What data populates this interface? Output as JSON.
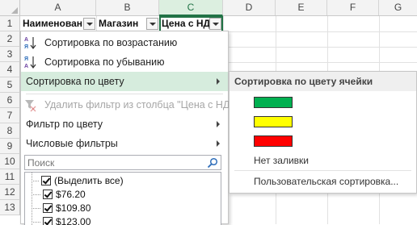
{
  "columns": [
    "A",
    "B",
    "C",
    "D",
    "E",
    "F",
    "G"
  ],
  "rows": [
    "1",
    "2",
    "3",
    "4",
    "5",
    "6",
    "7",
    "8",
    "9",
    "10",
    "11",
    "12",
    "13"
  ],
  "headers": {
    "a": "Наименован",
    "b": "Магазин",
    "c": "Цена с НДС"
  },
  "menu": {
    "sort_asc": "Сортировка по возрастанию",
    "sort_desc": "Сортировка по убыванию",
    "sort_by_color": "Сортировка по цвету",
    "clear_filter": "Удалить фильтр из столбца \"Цена с НДС\"",
    "filter_by_color": "Фильтр по цвету",
    "number_filters": "Числовые фильтры",
    "search_placeholder": "Поиск",
    "list_items": [
      "(Выделить все)",
      "$76.20",
      "$109.80",
      "$123.00"
    ]
  },
  "submenu": {
    "title": "Сортировка по цвету ячейки",
    "colors": [
      "#00b050",
      "#ffff00",
      "#ff0000"
    ],
    "no_fill": "Нет заливки",
    "custom_sort": "Пользовательская сортировка..."
  },
  "icons": {
    "sort_asc": "sort-ascending-icon",
    "sort_desc": "sort-descending-icon",
    "clear_filter": "clear-filter-icon",
    "search": "search-icon"
  },
  "accent_color": "#217346",
  "hover_color": "#d6ecdd"
}
